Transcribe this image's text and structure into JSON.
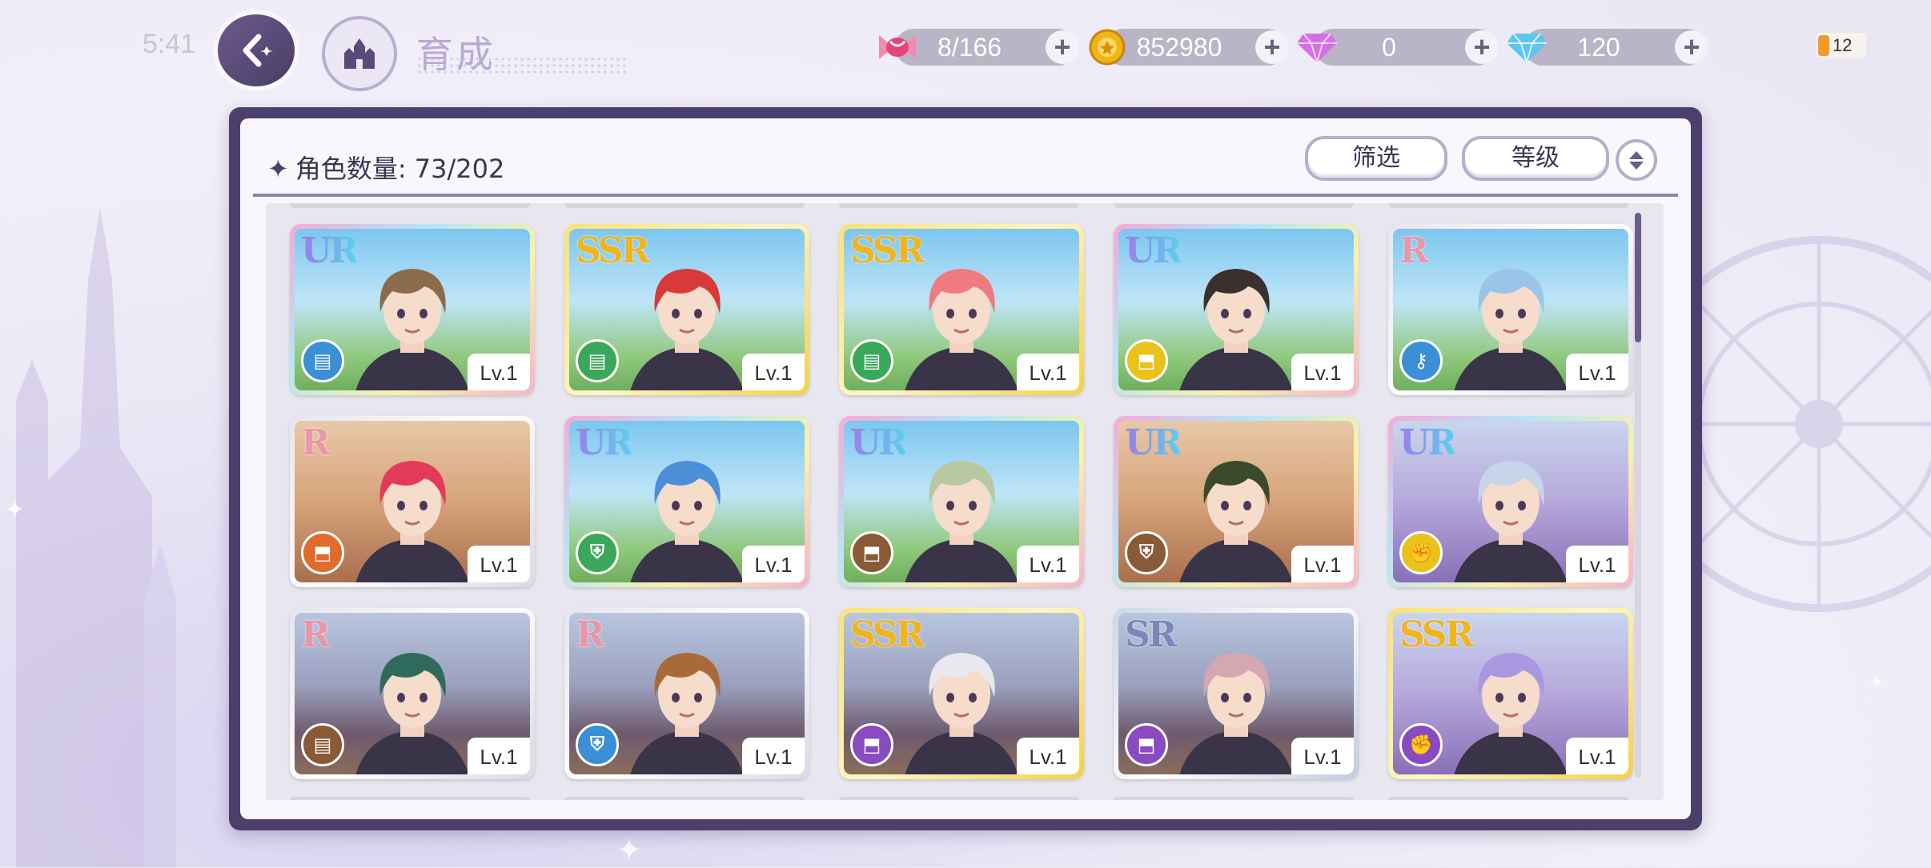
{
  "status": {
    "time": "5:41",
    "battery": "12"
  },
  "header": {
    "title": "育成"
  },
  "resources": [
    {
      "name": "candy",
      "icon": "candy-icon",
      "value": "8/166",
      "color": "#e4457a"
    },
    {
      "name": "gold-coin",
      "icon": "coin-icon",
      "value": "852980",
      "color": "#f0b418"
    },
    {
      "name": "pink-gem",
      "icon": "pink-gem-icon",
      "value": "0",
      "color": "#d66fe6"
    },
    {
      "name": "blue-diamond",
      "icon": "diamond-icon",
      "value": "120",
      "color": "#5cc5f0"
    }
  ],
  "panel": {
    "count_label": "角色数量: 73/202",
    "filter_label": "筛选",
    "sort_label": "等级"
  },
  "cards": [
    {
      "rarity": "UR",
      "attr": "book",
      "attr_color": "#3b8fd6",
      "bg": "sky",
      "level": "Lv.1",
      "hair": "#8b6b4a"
    },
    {
      "rarity": "SSR",
      "attr": "book",
      "attr_color": "#3aa85a",
      "bg": "sky",
      "level": "Lv.1",
      "hair": "#d83a3a"
    },
    {
      "rarity": "SSR",
      "attr": "book",
      "attr_color": "#3aa85a",
      "bg": "sky",
      "level": "Lv.1",
      "hair": "#ef7a80"
    },
    {
      "rarity": "UR",
      "attr": "boot",
      "attr_color": "#e9c21a",
      "bg": "sky",
      "level": "Lv.1",
      "hair": "#3a3030"
    },
    {
      "rarity": "R",
      "attr": "key",
      "attr_color": "#3b8fd6",
      "bg": "sky",
      "level": "Lv.1",
      "hair": "#9cc3e8"
    },
    {
      "rarity": "R",
      "attr": "boot",
      "attr_color": "#e26a2a",
      "bg": "desert",
      "level": "Lv.1",
      "hair": "#e43a5a"
    },
    {
      "rarity": "UR",
      "attr": "shield",
      "attr_color": "#3aa85a",
      "bg": "sky",
      "level": "Lv.1",
      "hair": "#4a8fd8"
    },
    {
      "rarity": "UR",
      "attr": "boot",
      "attr_color": "#8a5a36",
      "bg": "sky",
      "level": "Lv.1",
      "hair": "#b8c8a0"
    },
    {
      "rarity": "UR",
      "attr": "shield",
      "attr_color": "#8a5a36",
      "bg": "desert",
      "level": "Lv.1",
      "hair": "#3a4a2a"
    },
    {
      "rarity": "UR",
      "attr": "fist",
      "attr_color": "#e9c21a",
      "bg": "lavender",
      "level": "Lv.1",
      "hair": "#c8d4ec"
    },
    {
      "rarity": "R",
      "attr": "book",
      "attr_color": "#8a5a36",
      "bg": "temple",
      "level": "Lv.1",
      "hair": "#2f6a5a"
    },
    {
      "rarity": "R",
      "attr": "shield",
      "attr_color": "#3b8fd6",
      "bg": "temple",
      "level": "Lv.1",
      "hair": "#a86a3a"
    },
    {
      "rarity": "SSR",
      "attr": "boot",
      "attr_color": "#8a4ac0",
      "bg": "temple",
      "level": "Lv.1",
      "hair": "#e8e8ee"
    },
    {
      "rarity": "SR",
      "attr": "boot",
      "attr_color": "#8a4ac0",
      "bg": "temple",
      "level": "Lv.1",
      "hair": "#d4a8b0"
    },
    {
      "rarity": "SSR",
      "attr": "fist",
      "attr_color": "#8a4ac0",
      "bg": "lavender",
      "level": "Lv.1",
      "hair": "#a898e0"
    }
  ]
}
